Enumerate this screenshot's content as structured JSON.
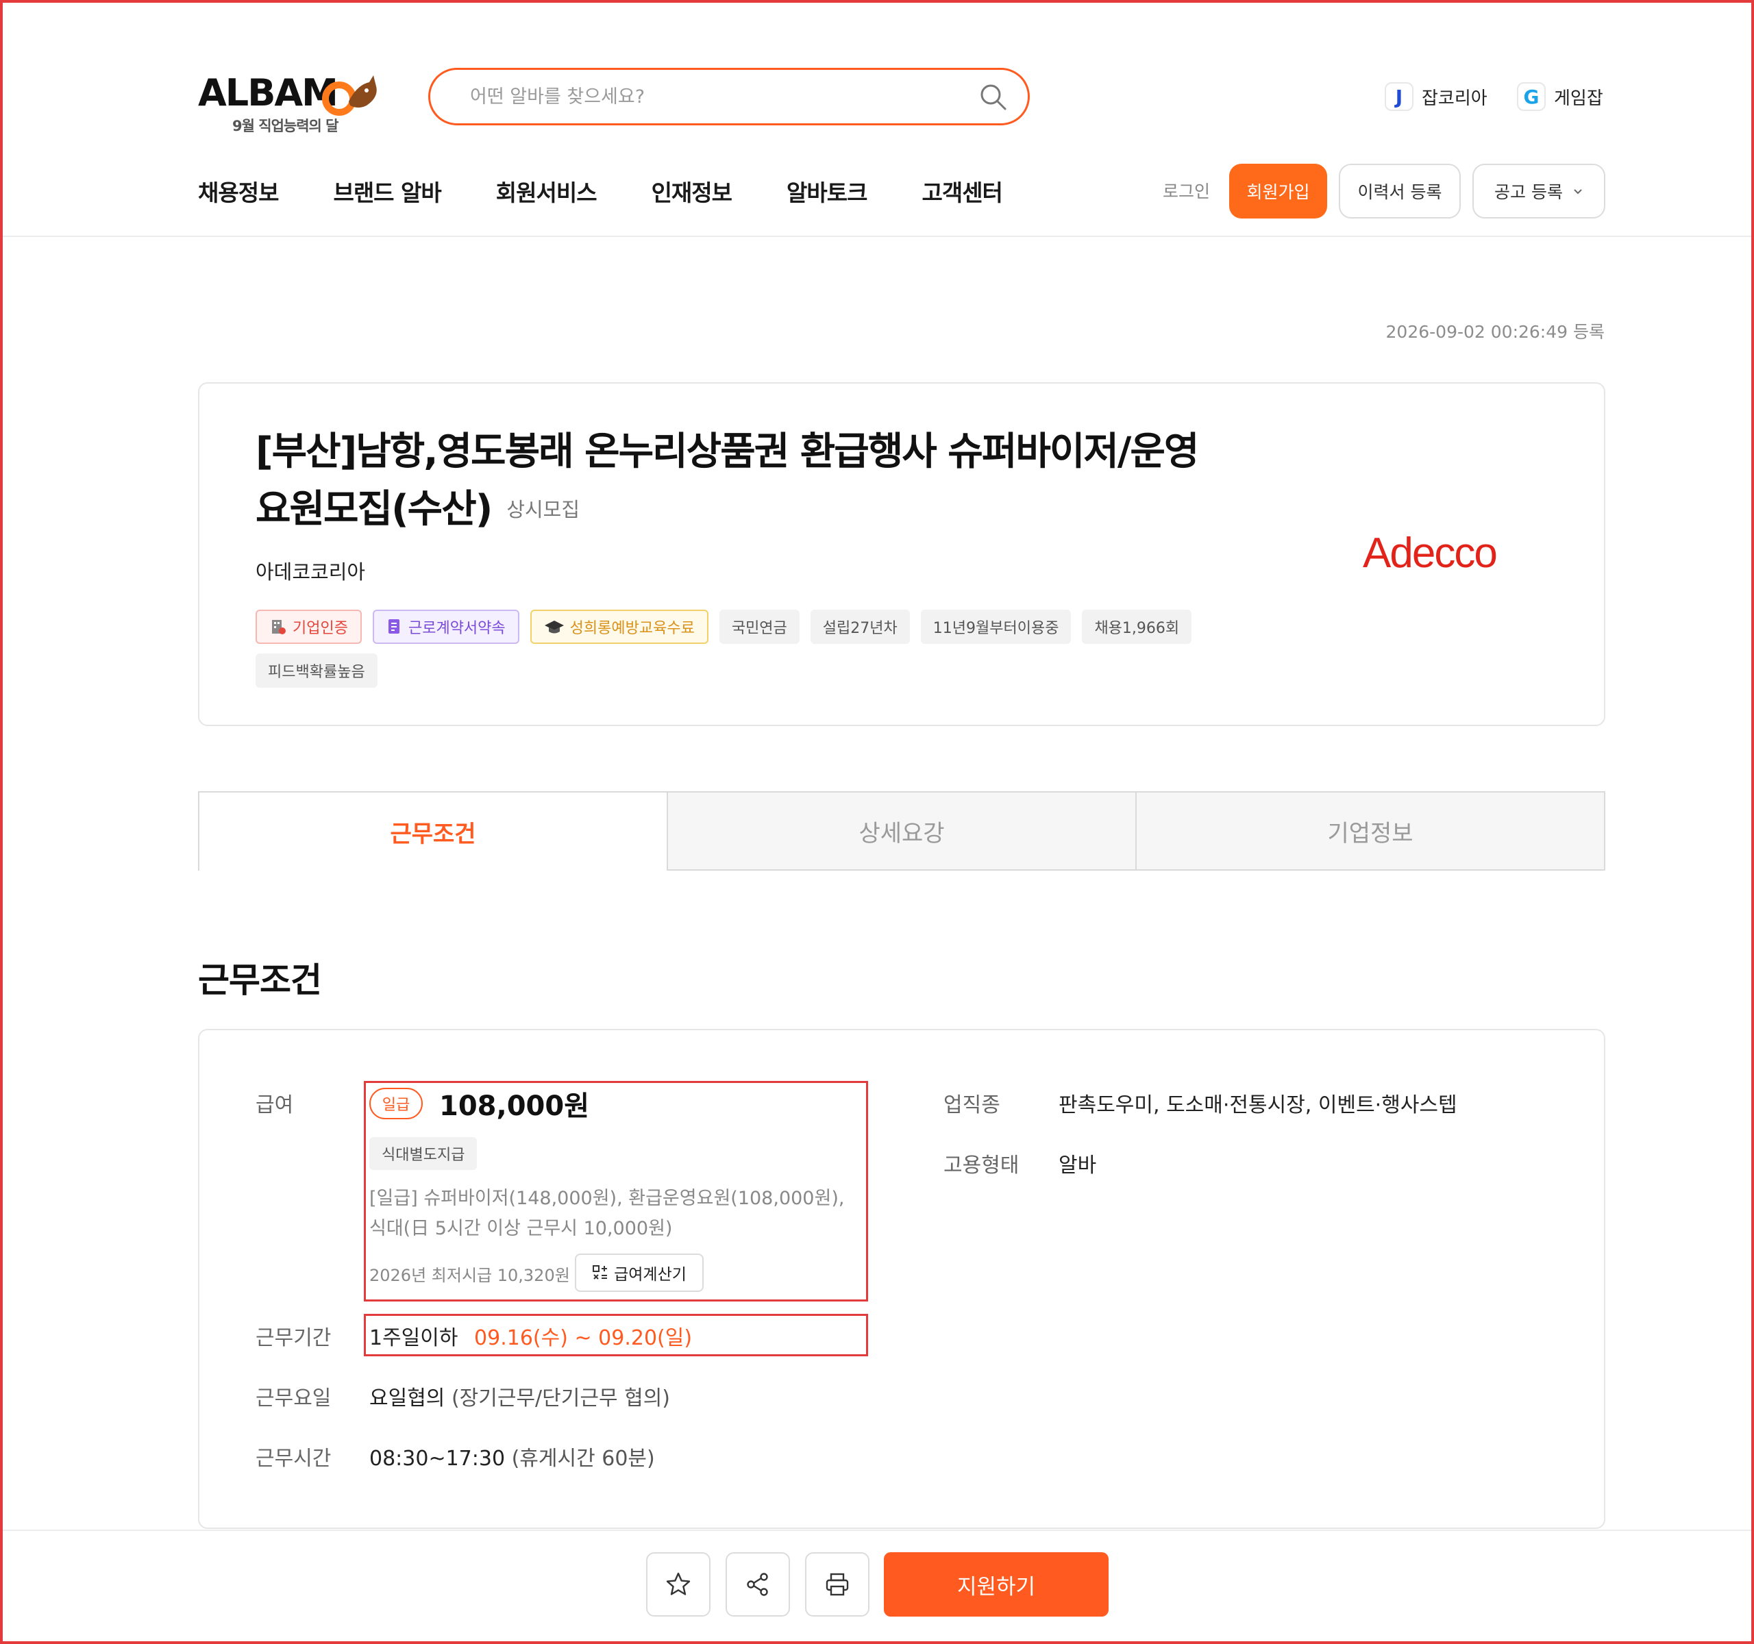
{
  "header": {
    "logo_text": "ALBAM",
    "logo_sub": "9월 직업능력의 달",
    "search_placeholder": "어떤 알바를 찾으세요?",
    "family_sites": [
      {
        "icon": "jobkorea-j-icon",
        "letter": "J",
        "label": "잡코리아",
        "color": "#1f4bd6"
      },
      {
        "icon": "gamejob-g-icon",
        "letter": "G",
        "label": "게임잡",
        "color": "#1aa3e8"
      }
    ],
    "nav": [
      "채용정보",
      "브랜드 알바",
      "회원서비스",
      "인재정보",
      "알바토크",
      "고객센터"
    ],
    "login": "로그인",
    "join": "회원가입",
    "resume": "이력서 등록",
    "post_job": "공고 등록"
  },
  "registered": "2026-09-02 00:26:49 등록",
  "job": {
    "title_line1": "[부산]남항,영도봉래 온누리상품권 환급행사 슈퍼바이저/운영",
    "title_line2": "요원모집(수산)",
    "recruit_type": "상시모집",
    "company": "아데코코리아",
    "company_logo_text": "Adecco",
    "tags": [
      {
        "label": "기업인증",
        "style": "red",
        "icon": "building-icon"
      },
      {
        "label": "근로계약서약속",
        "style": "purple",
        "icon": "document-icon"
      },
      {
        "label": "성희롱예방교육수료",
        "style": "yellow",
        "icon": "graduation-cap-icon"
      },
      {
        "label": "국민연금",
        "style": "plain"
      },
      {
        "label": "설립27년차",
        "style": "plain"
      },
      {
        "label": "11년9월부터이용중",
        "style": "plain"
      },
      {
        "label": "채용1,966회",
        "style": "plain"
      },
      {
        "label": "피드백확률높음",
        "style": "plain"
      }
    ]
  },
  "tabs": [
    "근무조건",
    "상세요강",
    "기업정보"
  ],
  "section_title": "근무조건",
  "conditions": {
    "pay_label": "급여",
    "pay_type": "일급",
    "pay_amount": "108,000원",
    "meal": "식대별도지급",
    "pay_note": "[일급] 슈퍼바이저(148,000원), 환급운영요원(108,000원), 식대(日 5시간 이상 근무시 10,000원)",
    "min_wage": "2026년 최저시급 10,320원",
    "calc_button": "급여계산기",
    "period_label": "근무기간",
    "period_value": "1주일이하",
    "period_dates": "09.16(수) ~ 09.20(일)",
    "days_label": "근무요일",
    "days_value": "요일협의",
    "days_note": "(장기근무/단기근무 협의)",
    "hours_label": "근무시간",
    "hours_value": "08:30~17:30",
    "hours_note": "(휴게시간 60분)",
    "industry_label": "업직종",
    "industry_value": "판촉도우미, 도소매·전통시장, 이벤트·행사스텝",
    "employment_label": "고용형태",
    "employment_value": "알바"
  },
  "bottom": {
    "apply": "지원하기",
    "icons": [
      "star-icon",
      "share-icon",
      "print-icon"
    ]
  },
  "colors": {
    "accent": "#ff5a1f",
    "highlight_box": "#e33b3b",
    "adecco": "#e2231a"
  }
}
